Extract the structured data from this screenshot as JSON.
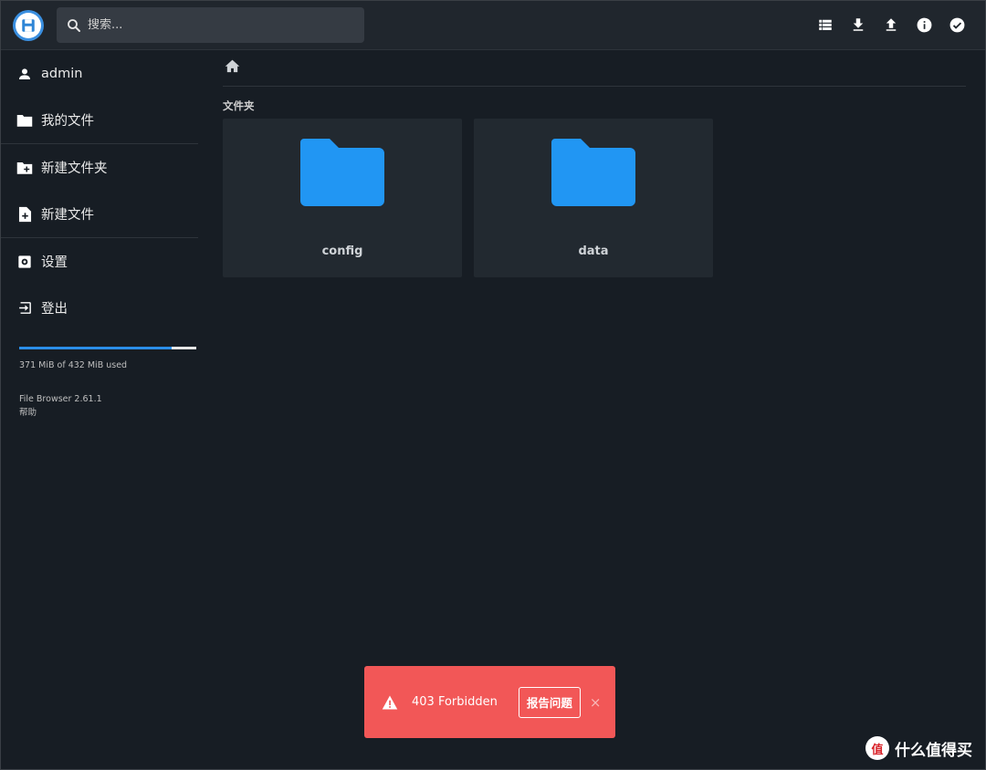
{
  "header": {
    "search_placeholder": "搜索...",
    "toolbar": [
      {
        "icon": "view-list-icon"
      },
      {
        "icon": "download-icon"
      },
      {
        "icon": "upload-icon"
      },
      {
        "icon": "info-icon"
      },
      {
        "icon": "select-check-icon"
      }
    ]
  },
  "sidebar": {
    "items": [
      {
        "label": "admin",
        "icon": "person-icon"
      },
      {
        "label": "我的文件",
        "icon": "folder-icon"
      },
      {
        "label": "新建文件夹",
        "icon": "create-folder-icon"
      },
      {
        "label": "新建文件",
        "icon": "note-add-icon"
      },
      {
        "label": "设置",
        "icon": "settings-icon"
      },
      {
        "label": "登出",
        "icon": "exit-icon"
      }
    ],
    "quota_text": "371 MiB of 432 MiB used",
    "quota_fraction": 0.859,
    "version": "File Browser 2.61.1",
    "help": "帮助"
  },
  "main": {
    "breadcrumb_icon": "home-icon",
    "section_title": "文件夹",
    "folders": [
      {
        "name": "config"
      },
      {
        "name": "data"
      }
    ]
  },
  "toast": {
    "message": "403 Forbidden",
    "report_label": "报告问题",
    "close_glyph": "×"
  },
  "watermark": {
    "logo_text": "值",
    "text": "什么值得买"
  },
  "colors": {
    "accent": "#2b8ee8",
    "folder": "#2196f3",
    "toast": "#f25757",
    "background": "#171d24"
  }
}
